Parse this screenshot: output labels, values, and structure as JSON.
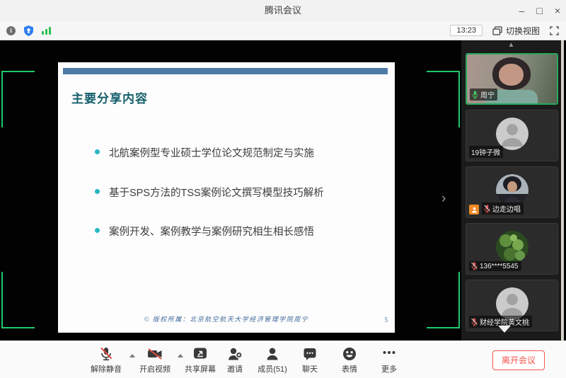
{
  "window": {
    "title": "腾讯会议",
    "minimize": "–",
    "maximize": "□",
    "close": "×"
  },
  "statusbar": {
    "time": "13:23",
    "switch_view_label": "切换视图"
  },
  "stage": {
    "collapse_chevron": "›",
    "scroll_up_glyph": "▲",
    "info_glyph": "i"
  },
  "slide": {
    "title": "主要分享内容",
    "bullets": [
      "北航案例型专业硕士学位论文规范制定与实施",
      "基于SPS方法的TSS案例论文撰写模型技巧解析",
      "案例开发、案例教学与案例研究相生相长感悟"
    ],
    "footer": "© 版权所属：北京航空航天大学经济管理学院周宁",
    "page_number": "5"
  },
  "participants": [
    {
      "name": "周宁",
      "mic": "on",
      "active_speaker": true,
      "video": true
    },
    {
      "name": "19钟子微",
      "mic": "hidden",
      "avatar": "silhouette"
    },
    {
      "name": "边走边唱",
      "mic": "muted",
      "avatar": "photo-person",
      "badge": "hand-raised"
    },
    {
      "name": "136****5545",
      "mic": "muted",
      "avatar": "photo-plants"
    },
    {
      "name": "财经学院黄文桃",
      "mic": "muted",
      "avatar": "silhouette"
    }
  ],
  "toolbar": {
    "items": [
      {
        "label": "解除静音",
        "icon": "mic-muted-icon"
      },
      {
        "label": "开启视频",
        "icon": "camera-off-icon"
      },
      {
        "label": "共享屏幕",
        "icon": "share-screen-icon"
      },
      {
        "label": "邀请",
        "icon": "invite-icon"
      },
      {
        "label": "成员(51)",
        "icon": "members-icon"
      },
      {
        "label": "聊天",
        "icon": "chat-icon"
      },
      {
        "label": "表情",
        "icon": "emoji-icon"
      },
      {
        "label": "更多",
        "icon": "more-icon"
      }
    ],
    "leave_label": "离开会议"
  },
  "colors": {
    "accent_green": "#1fc96e",
    "shield_blue": "#2f7ded",
    "danger_red": "#f2564d",
    "slide_header_blue": "#4e7aa6",
    "slide_title_teal": "#155f6b",
    "bullet_cyan": "#27b6c3",
    "muted_mic_red": "#e25555",
    "badge_orange": "#ef8a26"
  }
}
